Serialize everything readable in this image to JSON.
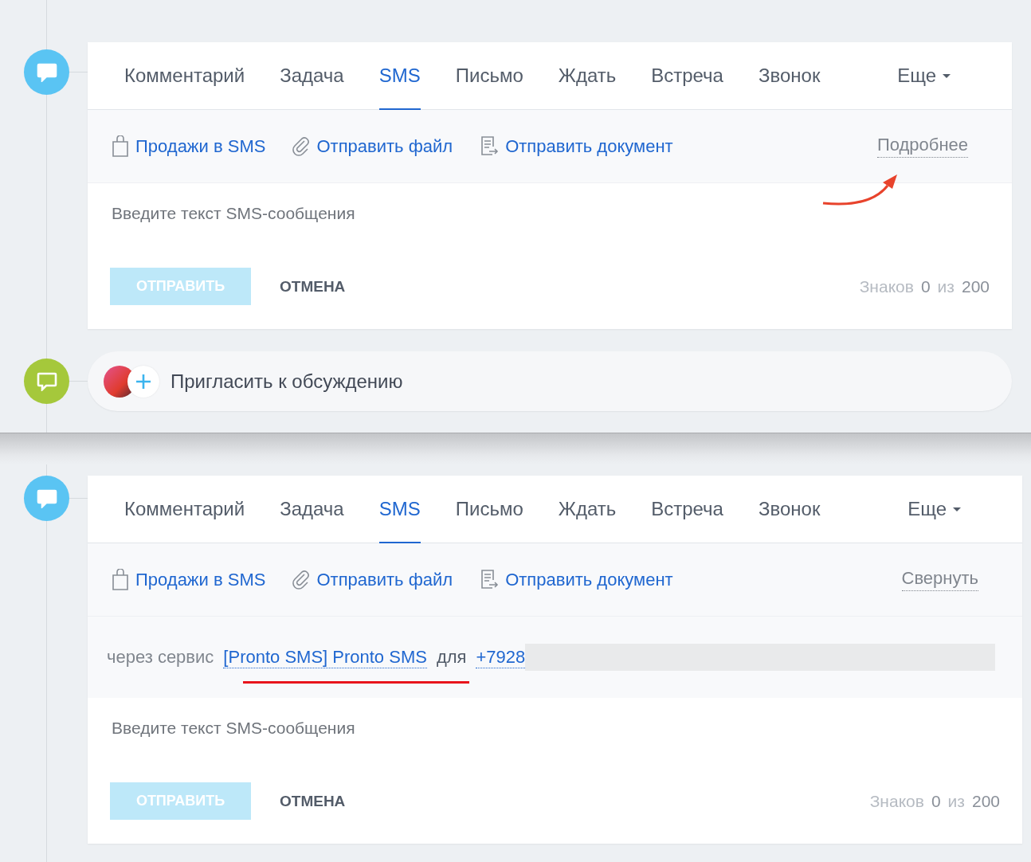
{
  "panels": [
    {
      "tabs": [
        {
          "label": "Комментарий",
          "selected": false,
          "kind": "tab"
        },
        {
          "label": "Задача",
          "selected": false,
          "kind": "tab"
        },
        {
          "label": "SMS",
          "selected": true,
          "kind": "tab"
        },
        {
          "label": "Письмо",
          "selected": false,
          "kind": "tab"
        },
        {
          "label": "Ждать",
          "selected": false,
          "kind": "tab"
        },
        {
          "label": "Встреча",
          "selected": false,
          "kind": "tab"
        },
        {
          "label": "Звонок",
          "selected": false,
          "kind": "tab"
        },
        {
          "label": "Еще",
          "selected": false,
          "kind": "dropdown"
        }
      ],
      "actions": [
        {
          "label": "Продажи в SMS",
          "kind": "bag"
        },
        {
          "label": "Отправить файл",
          "kind": "clip"
        },
        {
          "label": "Отправить документ",
          "kind": "doc"
        }
      ],
      "toggle": "Подробнее",
      "arrow_shown": true,
      "placeholder": "Введите текст SMS-сообщения",
      "send": {
        "label": "ОТПРАВИТЬ",
        "disabled": true
      },
      "cancel": "ОТМЕНА",
      "counter": {
        "label": "Знаков",
        "count": "0",
        "of": "из",
        "max": "200"
      },
      "invite": "Пригласить к обсуждению"
    },
    {
      "tabs": [
        {
          "label": "Комментарий",
          "selected": false,
          "kind": "tab"
        },
        {
          "label": "Задача",
          "selected": false,
          "kind": "tab"
        },
        {
          "label": "SMS",
          "selected": true,
          "kind": "tab"
        },
        {
          "label": "Письмо",
          "selected": false,
          "kind": "tab"
        },
        {
          "label": "Ждать",
          "selected": false,
          "kind": "tab"
        },
        {
          "label": "Встреча",
          "selected": false,
          "kind": "tab"
        },
        {
          "label": "Звонок",
          "selected": false,
          "kind": "tab"
        },
        {
          "label": "Еще",
          "selected": false,
          "kind": "dropdown"
        }
      ],
      "actions": [
        {
          "label": "Продажи в SMS",
          "kind": "bag"
        },
        {
          "label": "Отправить файл",
          "kind": "clip"
        },
        {
          "label": "Отправить документ",
          "kind": "doc"
        }
      ],
      "toggle": "Свернуть",
      "underline_shown": true,
      "service": {
        "prefix": "через сервис",
        "provider": "[Pronto SMS] Pronto SMS",
        "for": "для",
        "phone": "+7928"
      },
      "placeholder": "Введите текст SMS-сообщения",
      "send": {
        "label": "ОТПРАВИТЬ",
        "disabled": true
      },
      "cancel": "ОТМЕНА",
      "counter": {
        "label": "Знаков",
        "count": "0",
        "of": "из",
        "max": "200"
      }
    }
  ]
}
